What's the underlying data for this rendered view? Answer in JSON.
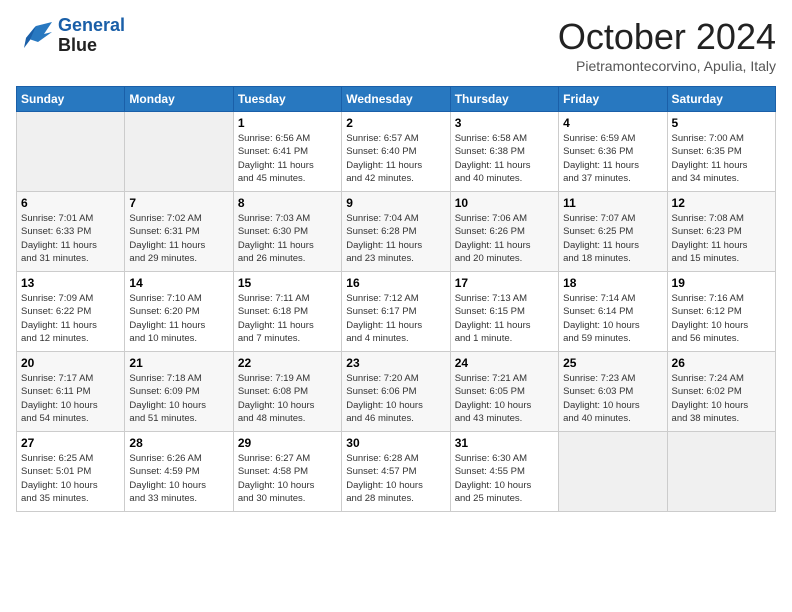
{
  "header": {
    "logo_line1": "General",
    "logo_line2": "Blue",
    "month": "October 2024",
    "location": "Pietramontecorvino, Apulia, Italy"
  },
  "weekdays": [
    "Sunday",
    "Monday",
    "Tuesday",
    "Wednesday",
    "Thursday",
    "Friday",
    "Saturday"
  ],
  "weeks": [
    [
      {
        "day": "",
        "info": ""
      },
      {
        "day": "",
        "info": ""
      },
      {
        "day": "1",
        "info": "Sunrise: 6:56 AM\nSunset: 6:41 PM\nDaylight: 11 hours\nand 45 minutes."
      },
      {
        "day": "2",
        "info": "Sunrise: 6:57 AM\nSunset: 6:40 PM\nDaylight: 11 hours\nand 42 minutes."
      },
      {
        "day": "3",
        "info": "Sunrise: 6:58 AM\nSunset: 6:38 PM\nDaylight: 11 hours\nand 40 minutes."
      },
      {
        "day": "4",
        "info": "Sunrise: 6:59 AM\nSunset: 6:36 PM\nDaylight: 11 hours\nand 37 minutes."
      },
      {
        "day": "5",
        "info": "Sunrise: 7:00 AM\nSunset: 6:35 PM\nDaylight: 11 hours\nand 34 minutes."
      }
    ],
    [
      {
        "day": "6",
        "info": "Sunrise: 7:01 AM\nSunset: 6:33 PM\nDaylight: 11 hours\nand 31 minutes."
      },
      {
        "day": "7",
        "info": "Sunrise: 7:02 AM\nSunset: 6:31 PM\nDaylight: 11 hours\nand 29 minutes."
      },
      {
        "day": "8",
        "info": "Sunrise: 7:03 AM\nSunset: 6:30 PM\nDaylight: 11 hours\nand 26 minutes."
      },
      {
        "day": "9",
        "info": "Sunrise: 7:04 AM\nSunset: 6:28 PM\nDaylight: 11 hours\nand 23 minutes."
      },
      {
        "day": "10",
        "info": "Sunrise: 7:06 AM\nSunset: 6:26 PM\nDaylight: 11 hours\nand 20 minutes."
      },
      {
        "day": "11",
        "info": "Sunrise: 7:07 AM\nSunset: 6:25 PM\nDaylight: 11 hours\nand 18 minutes."
      },
      {
        "day": "12",
        "info": "Sunrise: 7:08 AM\nSunset: 6:23 PM\nDaylight: 11 hours\nand 15 minutes."
      }
    ],
    [
      {
        "day": "13",
        "info": "Sunrise: 7:09 AM\nSunset: 6:22 PM\nDaylight: 11 hours\nand 12 minutes."
      },
      {
        "day": "14",
        "info": "Sunrise: 7:10 AM\nSunset: 6:20 PM\nDaylight: 11 hours\nand 10 minutes."
      },
      {
        "day": "15",
        "info": "Sunrise: 7:11 AM\nSunset: 6:18 PM\nDaylight: 11 hours\nand 7 minutes."
      },
      {
        "day": "16",
        "info": "Sunrise: 7:12 AM\nSunset: 6:17 PM\nDaylight: 11 hours\nand 4 minutes."
      },
      {
        "day": "17",
        "info": "Sunrise: 7:13 AM\nSunset: 6:15 PM\nDaylight: 11 hours\nand 1 minute."
      },
      {
        "day": "18",
        "info": "Sunrise: 7:14 AM\nSunset: 6:14 PM\nDaylight: 10 hours\nand 59 minutes."
      },
      {
        "day": "19",
        "info": "Sunrise: 7:16 AM\nSunset: 6:12 PM\nDaylight: 10 hours\nand 56 minutes."
      }
    ],
    [
      {
        "day": "20",
        "info": "Sunrise: 7:17 AM\nSunset: 6:11 PM\nDaylight: 10 hours\nand 54 minutes."
      },
      {
        "day": "21",
        "info": "Sunrise: 7:18 AM\nSunset: 6:09 PM\nDaylight: 10 hours\nand 51 minutes."
      },
      {
        "day": "22",
        "info": "Sunrise: 7:19 AM\nSunset: 6:08 PM\nDaylight: 10 hours\nand 48 minutes."
      },
      {
        "day": "23",
        "info": "Sunrise: 7:20 AM\nSunset: 6:06 PM\nDaylight: 10 hours\nand 46 minutes."
      },
      {
        "day": "24",
        "info": "Sunrise: 7:21 AM\nSunset: 6:05 PM\nDaylight: 10 hours\nand 43 minutes."
      },
      {
        "day": "25",
        "info": "Sunrise: 7:23 AM\nSunset: 6:03 PM\nDaylight: 10 hours\nand 40 minutes."
      },
      {
        "day": "26",
        "info": "Sunrise: 7:24 AM\nSunset: 6:02 PM\nDaylight: 10 hours\nand 38 minutes."
      }
    ],
    [
      {
        "day": "27",
        "info": "Sunrise: 6:25 AM\nSunset: 5:01 PM\nDaylight: 10 hours\nand 35 minutes."
      },
      {
        "day": "28",
        "info": "Sunrise: 6:26 AM\nSunset: 4:59 PM\nDaylight: 10 hours\nand 33 minutes."
      },
      {
        "day": "29",
        "info": "Sunrise: 6:27 AM\nSunset: 4:58 PM\nDaylight: 10 hours\nand 30 minutes."
      },
      {
        "day": "30",
        "info": "Sunrise: 6:28 AM\nSunset: 4:57 PM\nDaylight: 10 hours\nand 28 minutes."
      },
      {
        "day": "31",
        "info": "Sunrise: 6:30 AM\nSunset: 4:55 PM\nDaylight: 10 hours\nand 25 minutes."
      },
      {
        "day": "",
        "info": ""
      },
      {
        "day": "",
        "info": ""
      }
    ]
  ]
}
